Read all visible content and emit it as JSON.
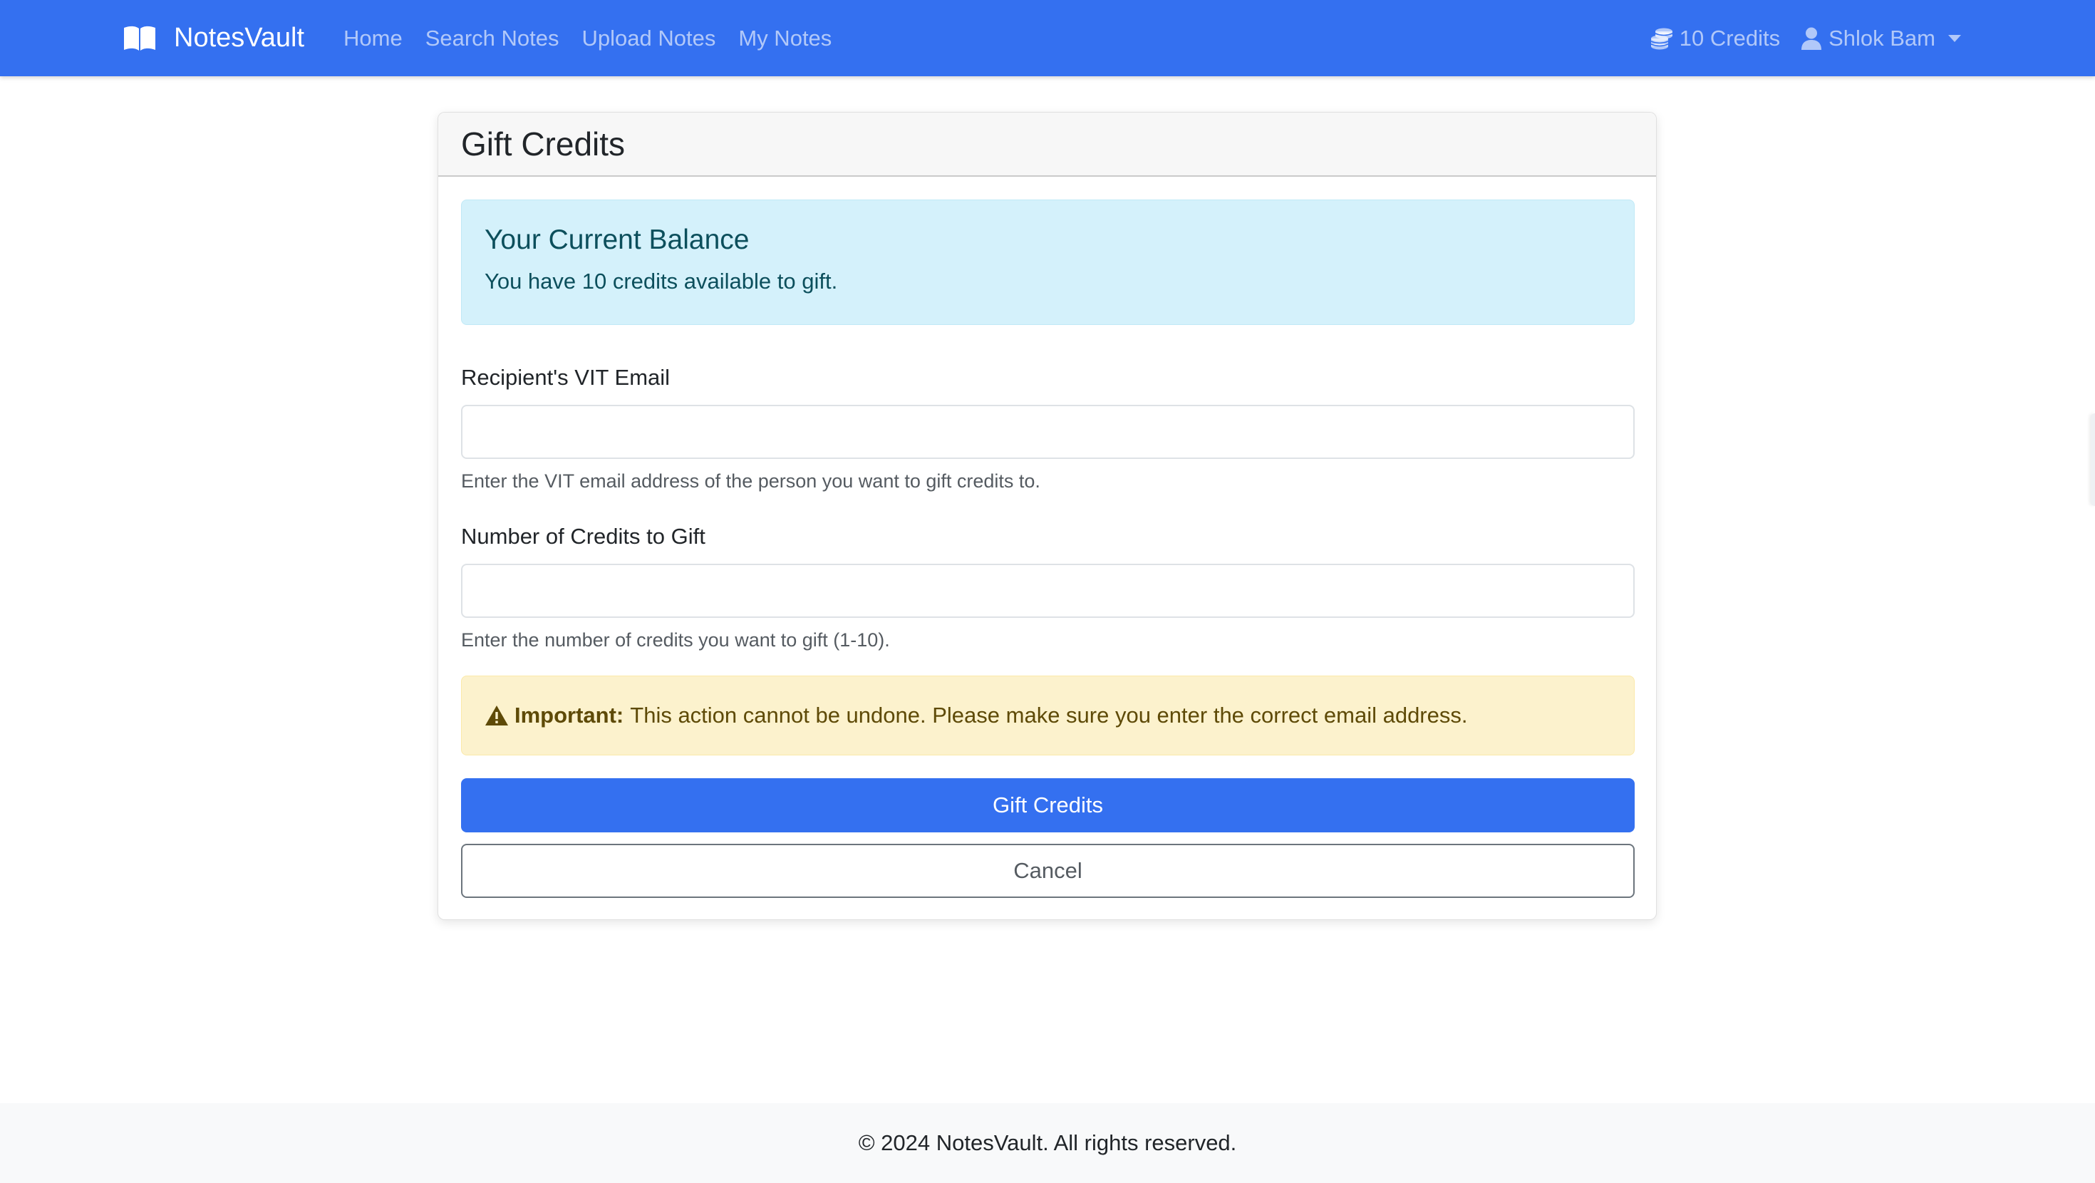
{
  "navbar": {
    "brand": "NotesVault",
    "brand_icon": "book-open-icon",
    "links": [
      "Home",
      "Search Notes",
      "Upload Notes",
      "My Notes"
    ],
    "credits_icon": "coins-icon",
    "credits_label": "10 Credits",
    "user_icon": "user-icon",
    "user_name": "Shlok Bam",
    "accent_color": "#3470f0"
  },
  "card": {
    "title": "Gift Credits",
    "balance": {
      "title": "Your Current Balance",
      "text": "You have 10 credits available to gift."
    },
    "email_field": {
      "label": "Recipient's VIT Email",
      "value": "",
      "placeholder": "",
      "help": "Enter the VIT email address of the person you want to gift credits to."
    },
    "credits_field": {
      "label": "Number of Credits to Gift",
      "value": "",
      "placeholder": "",
      "help": "Enter the number of credits you want to gift (1-10)."
    },
    "warning": {
      "icon": "warning-triangle-icon",
      "strong": "Important:",
      "text": "This action cannot be undone. Please make sure you enter the correct email address."
    },
    "submit_label": "Gift Credits",
    "cancel_label": "Cancel"
  },
  "footer": {
    "text": "© 2024 NotesVault. All rights reserved."
  }
}
